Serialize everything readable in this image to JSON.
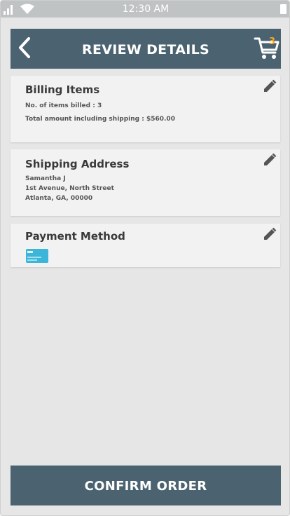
{
  "status_bar": {
    "time": "12:30 AM"
  },
  "header": {
    "title": "REVIEW DETAILS",
    "cart_count": "3"
  },
  "billing": {
    "title": "Billing Items",
    "items_billed": "No. of items billed  : 3",
    "total": "Total amount including shipping  : $560.00"
  },
  "shipping": {
    "title": "Shipping Address",
    "name": "Samantha J",
    "street": "1st Avenue, North Street",
    "city": "Atlanta, GA, 00000"
  },
  "payment": {
    "title": "Payment Method",
    "card_icon": "credit-card-icon"
  },
  "confirm": {
    "label": "CONFIRM ORDER"
  },
  "colors": {
    "header_bg": "#4b6370",
    "cart_badge": "#f5a623",
    "card_icon": "#3bb5d8",
    "page_bg": "#e6e6e6"
  }
}
